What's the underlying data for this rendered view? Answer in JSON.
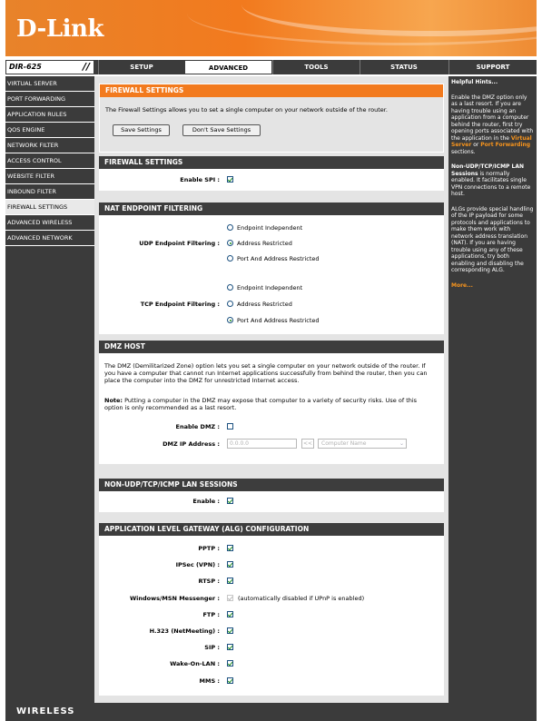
{
  "brand": {
    "logo": "D-Link",
    "model": "DIR-625",
    "footer": "WIRELESS"
  },
  "tabs": [
    "SETUP",
    "ADVANCED",
    "TOOLS",
    "STATUS",
    "SUPPORT"
  ],
  "sidebar": [
    "VIRTUAL SERVER",
    "PORT FORWARDING",
    "APPLICATION RULES",
    "QOS ENGINE",
    "NETWORK FILTER",
    "ACCESS CONTROL",
    "WEBSITE FILTER",
    "INBOUND FILTER",
    "FIREWALL SETTINGS",
    "ADVANCED WIRELESS",
    "ADVANCED NETWORK"
  ],
  "fw": {
    "title": "FIREWALL SETTINGS",
    "intro": "The Firewall Settings allows you to set a single computer on your network outside of the router.",
    "save": "Save Settings",
    "dont": "Don't Save Settings"
  },
  "fw2": {
    "title": "FIREWALL SETTINGS",
    "spi_label": "Enable SPI :"
  },
  "nat": {
    "title": "NAT ENDPOINT FILTERING",
    "udp_label": "UDP Endpoint Filtering :",
    "tcp_label": "TCP Endpoint Filtering :",
    "opt1": "Endpoint Independent",
    "opt2": "Address Restricted",
    "opt3": "Port And Address Restricted",
    "udp_selected": "Address Restricted",
    "tcp_selected": "Port And Address Restricted"
  },
  "dmz": {
    "title": "DMZ HOST",
    "desc1": "The DMZ (Demilitarized Zone) option lets you set a single computer on your network outside of the router. If",
    "desc2": "you have a computer that cannot run Internet applications successfully from behind the router, then you can",
    "desc3": "place the computer into the DMZ for unrestricted Internet access.",
    "note_b": "Note:",
    "note1": " Putting a computer in the DMZ may expose that computer to a variety of security risks. Use of this",
    "note2": "option is only recommended as a last resort.",
    "enable_label": "Enable DMZ :",
    "ip_label": "DMZ IP Address :",
    "ip_placeholder": "0.0.0.0",
    "arrow": "<<",
    "computer_name": "Computer Name"
  },
  "lan": {
    "title": "NON-UDP/TCP/ICMP LAN SESSIONS",
    "enable_label": "Enable :"
  },
  "alg": {
    "title": "APPLICATION LEVEL GATEWAY (ALG) CONFIGURATION",
    "items": [
      {
        "label": "PPTP :"
      },
      {
        "label": "IPSec (VPN) :"
      },
      {
        "label": "RTSP :"
      },
      {
        "label": "Windows/MSN Messenger :",
        "note": "(automatically disabled if UPnP is enabled)"
      },
      {
        "label": "FTP :"
      },
      {
        "label": "H.323 (NetMeeting) :"
      },
      {
        "label": "SIP :"
      },
      {
        "label": "Wake-On-LAN :"
      },
      {
        "label": "MMS :"
      }
    ]
  },
  "help": {
    "title": "Helpful Hints...",
    "p1a": "Enable the DMZ option only as a last resort. If you are having trouble using an application from a computer behind the router, first try opening ports associated with the application in the ",
    "p1b": "Virtual Server",
    "p1c": " or ",
    "p1d": "Port Forwarding",
    "p1e": " sections.",
    "p2a": "Non-UDP/TCP/ICMP LAN Sessions",
    "p2b": " is normally enabled. It facilitates single VPN connections to a remote host.",
    "p3": "ALGs provide special handling of the IP payload for some protocols and applications to make them work with network address translation (NAT). If you are having trouble using any of these applications, try both enabling and disabling the corresponding ALG.",
    "more": "More..."
  }
}
